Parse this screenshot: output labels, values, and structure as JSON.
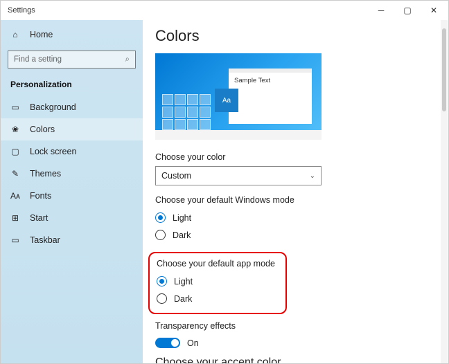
{
  "window": {
    "title": "Settings"
  },
  "sidebar": {
    "home": "Home",
    "search_placeholder": "Find a setting",
    "category": "Personalization",
    "items": [
      {
        "label": "Background",
        "icon": "▭"
      },
      {
        "label": "Colors",
        "icon": "❀"
      },
      {
        "label": "Lock screen",
        "icon": "▢"
      },
      {
        "label": "Themes",
        "icon": "✎"
      },
      {
        "label": "Fonts",
        "icon": "Aᴀ"
      },
      {
        "label": "Start",
        "icon": "⊞"
      },
      {
        "label": "Taskbar",
        "icon": "▭"
      }
    ],
    "active_index": 1
  },
  "page": {
    "title": "Colors",
    "preview_sample": "Sample Text",
    "preview_aa": "Aa",
    "choose_color_label": "Choose your color",
    "choose_color_value": "Custom",
    "windows_mode": {
      "label": "Choose your default Windows mode",
      "options": [
        "Light",
        "Dark"
      ],
      "selected": "Light"
    },
    "app_mode": {
      "label": "Choose your default app mode",
      "options": [
        "Light",
        "Dark"
      ],
      "selected": "Light"
    },
    "transparency": {
      "label": "Transparency effects",
      "state": "On"
    },
    "accent_title": "Choose your accent color"
  }
}
